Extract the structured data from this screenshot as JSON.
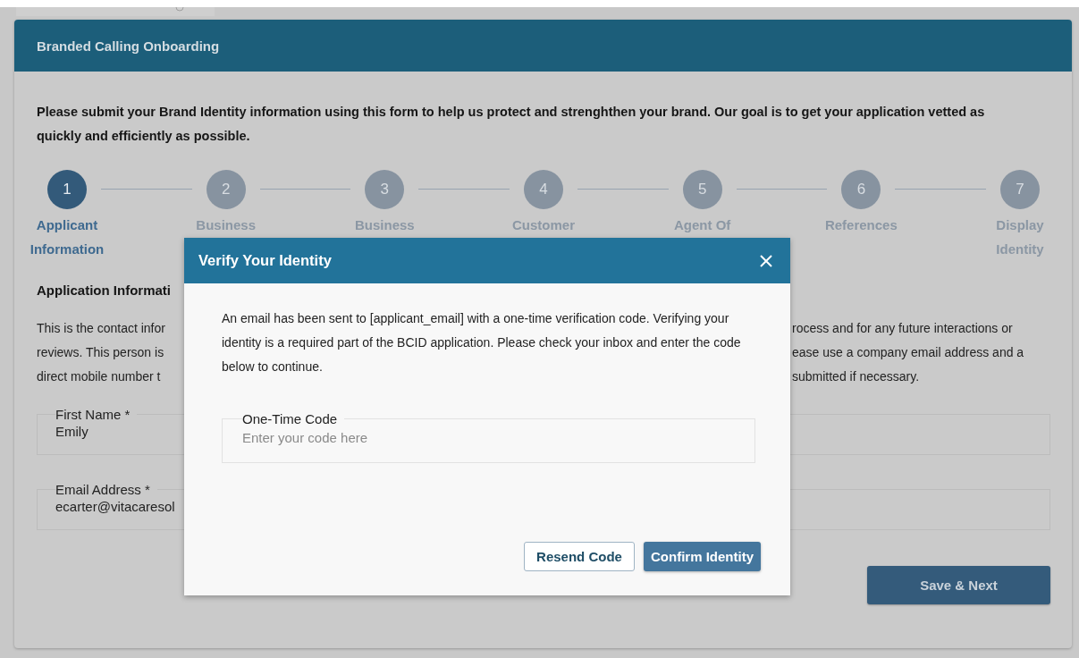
{
  "card": {
    "title": "Branded Calling Onboarding",
    "intro": "Please submit your Brand Identity information using this form to help us protect and strenghthen your brand. Our goal is to get your application vetted as quickly and efficiently as possible.",
    "steps": [
      {
        "number": "1",
        "label": "Applicant Information",
        "selected": true
      },
      {
        "number": "2",
        "label": "Business",
        "selected": false
      },
      {
        "number": "3",
        "label": "Business",
        "selected": false
      },
      {
        "number": "4",
        "label": "Customer",
        "selected": false
      },
      {
        "number": "5",
        "label": "Agent Of",
        "selected": false
      },
      {
        "number": "6",
        "label": "References",
        "selected": false
      },
      {
        "number": "7",
        "label": "Display Identity",
        "selected": false
      }
    ],
    "section_title": "Application Informati",
    "description_lines": [
      {
        "left": "This is the contact infor",
        "right": "rocess and for any future interactions or"
      },
      {
        "left": "reviews. This person is",
        "right": "ease use a company email address and a"
      },
      {
        "left": "direct mobile number t",
        "right": "submitted if necessary."
      }
    ],
    "fields": [
      {
        "label": "First Name *",
        "value": "Emily"
      },
      {
        "label": "Email Address *",
        "value": "ecarter@vitacaresol"
      }
    ],
    "next_button": "Save & Next"
  },
  "dialog": {
    "title": "Verify Your Identity",
    "message": "An email has been sent to [applicant_email] with a one-time verification code. Verifying your identity is a required part of the BCID application. Please check your inbox and enter the code below to continue.",
    "code_field": {
      "label": "One-Time Code",
      "placeholder": "Enter your code here"
    },
    "buttons": [
      {
        "label": "Resend Code",
        "kind": "secondary"
      },
      {
        "label": "Confirm Identity",
        "kind": "primary"
      }
    ]
  }
}
